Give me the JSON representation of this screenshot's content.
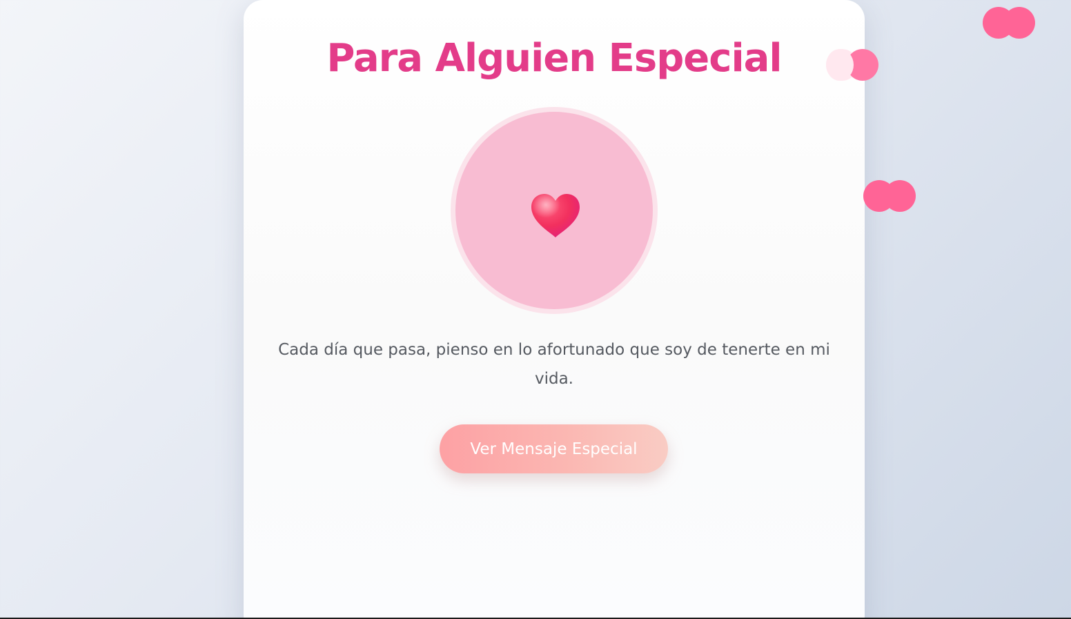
{
  "card": {
    "title": "Para Alguien Especial",
    "message": "Cada día que pasa, pienso en lo afortunado que soy de tenerte en mi vida.",
    "button_label": "Ver Mensaje Especial"
  },
  "icons": {
    "center": "heart-icon",
    "floating": "floating-heart-icon"
  },
  "colors": {
    "title": "#e33c89",
    "circle": "#f8bcd2",
    "circle_ring": "#fbe3eb",
    "floating_heart": "#ff6496",
    "floating_heart_faded": "#ffe8ef",
    "button_start": "#fda1a4",
    "button_end": "#f9ccc4",
    "message_text": "#555960"
  }
}
